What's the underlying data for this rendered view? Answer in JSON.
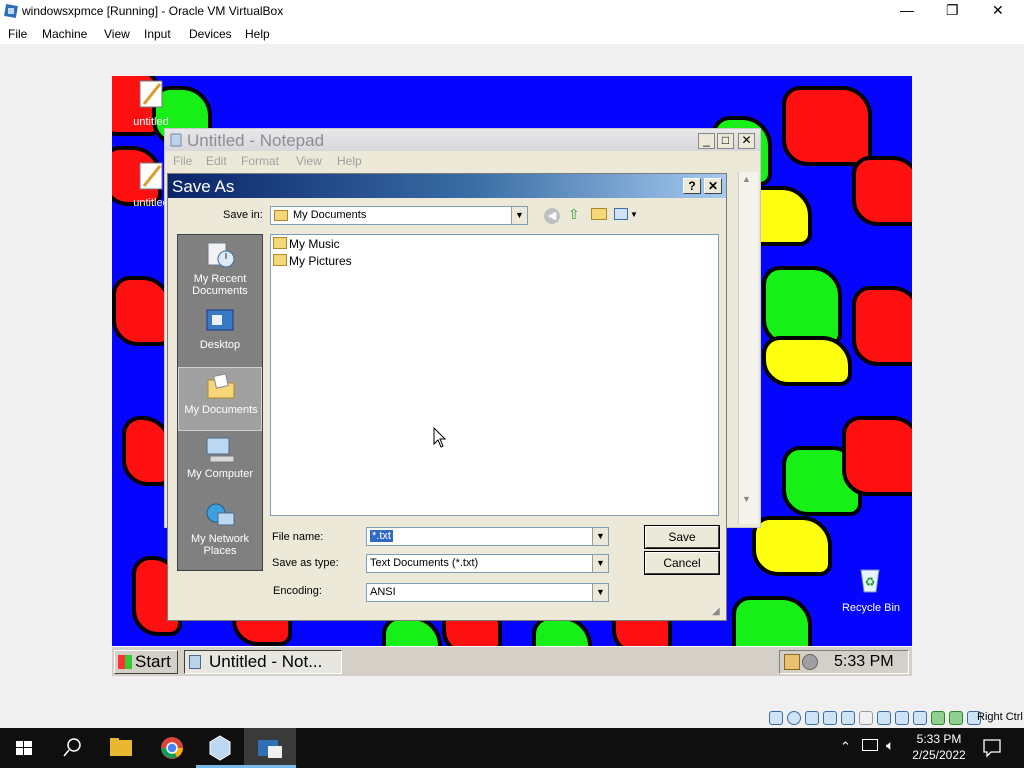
{
  "host": {
    "window_title": "windowsxpmce [Running] - Oracle VM VirtualBox",
    "menu": [
      "File",
      "Machine",
      "View",
      "Input",
      "Devices",
      "Help"
    ],
    "controls": {
      "minimize": "—",
      "maximize": "❐",
      "close": "✕"
    },
    "status_host_key": "Right Ctrl"
  },
  "guest": {
    "desktop_icons": [
      {
        "label": "untitled",
        "icon": "notepad-file-icon"
      },
      {
        "label": "untitled",
        "icon": "notepad-file-icon"
      },
      {
        "label": "Recycle Bin",
        "icon": "recycle-bin-icon"
      }
    ],
    "notepad": {
      "title": "Untitled - Notepad",
      "menu": [
        "File",
        "Edit",
        "Format",
        "View",
        "Help"
      ],
      "controls": {
        "minimize": "_",
        "maximize": "□",
        "close": "✕"
      }
    },
    "save_as": {
      "title": "Save As",
      "help_btn": "?",
      "close_btn": "✕",
      "save_in_label": "Save in:",
      "save_in_value": "My Documents",
      "places": [
        "My Recent Documents",
        "Desktop",
        "My Documents",
        "My Computer",
        "My Network Places"
      ],
      "selected_place": "My Documents",
      "files": [
        "My Music",
        "My Pictures"
      ],
      "file_name_label": "File name:",
      "file_name_value": "*.txt",
      "save_as_type_label": "Save as type:",
      "save_as_type_value": "Text Documents (*.txt)",
      "encoding_label": "Encoding:",
      "encoding_value": "ANSI",
      "save_btn": "Save",
      "cancel_btn": "Cancel"
    },
    "taskbar": {
      "start": "Start",
      "task": "Untitled - Not...",
      "clock": "5:33 PM"
    }
  },
  "win10_taskbar": {
    "time": "5:33 PM",
    "date": "2/25/2022"
  },
  "colors": {
    "desktop_blue": "#0505ff",
    "flag_red": "#ff1010",
    "flag_green": "#17f017",
    "flag_yellow": "#ffff10",
    "dialog_title": "#0a246a"
  }
}
